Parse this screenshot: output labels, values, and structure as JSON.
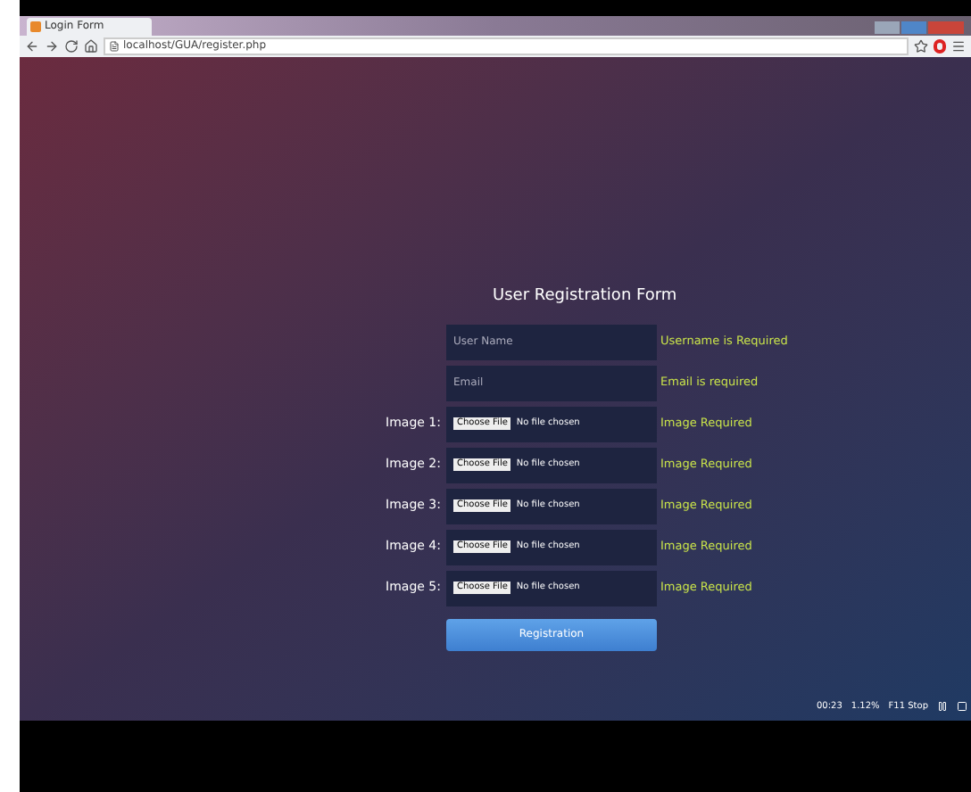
{
  "browser": {
    "tab_title": "Login Form",
    "url": "localhost/GUA/register.php"
  },
  "form": {
    "title": "User Registration Form",
    "fields": [
      {
        "kind": "text",
        "placeholder": "User Name",
        "error": "Username is Required"
      },
      {
        "kind": "text",
        "placeholder": "Email",
        "error": "Email is required"
      },
      {
        "kind": "file",
        "label": "Image 1:",
        "button": "Choose File",
        "status": "No file chosen",
        "error": "Image Required"
      },
      {
        "kind": "file",
        "label": "Image 2:",
        "button": "Choose File",
        "status": "No file chosen",
        "error": "Image Required"
      },
      {
        "kind": "file",
        "label": "Image 3:",
        "button": "Choose File",
        "status": "No file chosen",
        "error": "Image Required"
      },
      {
        "kind": "file",
        "label": "Image 4:",
        "button": "Choose File",
        "status": "No file chosen",
        "error": "Image Required"
      },
      {
        "kind": "file",
        "label": "Image 5:",
        "button": "Choose File",
        "status": "No file chosen",
        "error": "Image Required"
      }
    ],
    "submit": "Registration"
  },
  "recorder": {
    "time": "00:23",
    "cpu": "1.12%",
    "stop": "F11 Stop"
  }
}
